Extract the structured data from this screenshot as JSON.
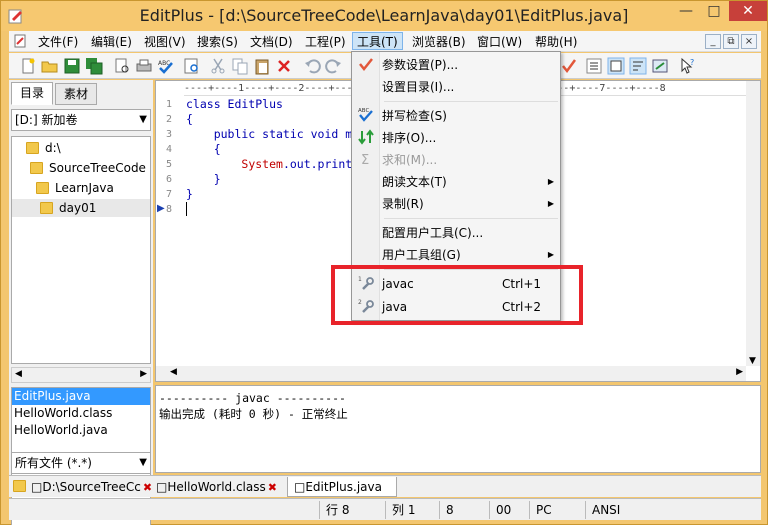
{
  "window": {
    "title": "EditPlus - [d:\\SourceTreeCode\\LearnJava\\day01\\EditPlus.java]"
  },
  "menubar": {
    "items": [
      {
        "label": "文件(F)"
      },
      {
        "label": "编辑(E)"
      },
      {
        "label": "视图(V)"
      },
      {
        "label": "搜索(S)"
      },
      {
        "label": "文档(D)"
      },
      {
        "label": "工程(P)"
      },
      {
        "label": "工具(T)"
      },
      {
        "label": "浏览器(B)"
      },
      {
        "label": "窗口(W)"
      },
      {
        "label": "帮助(H)"
      }
    ]
  },
  "sidebar": {
    "tabs": [
      {
        "label": "目录"
      },
      {
        "label": "素材"
      }
    ],
    "drive": "[D:] 新加卷",
    "tree": [
      {
        "label": "d:\\"
      },
      {
        "label": "SourceTreeCode"
      },
      {
        "label": "LearnJava"
      },
      {
        "label": "day01"
      }
    ],
    "files": [
      {
        "label": "EditPlus.java"
      },
      {
        "label": "HelloWorld.class"
      },
      {
        "label": "HelloWorld.java"
      }
    ],
    "filter": "所有文件 (*.*)"
  },
  "editor": {
    "ruler": "----+----1----+----2----+----3----+----4----+----5----+----6----+----7----+----8",
    "lines": [
      {
        "num": "1",
        "text": "class EditPlus"
      },
      {
        "num": "2",
        "text": "{"
      },
      {
        "num": "3",
        "text": "    public static void m"
      },
      {
        "num": "4",
        "text": "    {"
      },
      {
        "num": "5",
        "pre": "        ",
        "str": "System",
        "post": ".out.print"
      },
      {
        "num": "6",
        "text": "    }"
      },
      {
        "num": "7",
        "text": "}"
      },
      {
        "num": "8",
        "text": ""
      }
    ]
  },
  "output": {
    "lines": [
      "---------- javac ----------",
      "输出完成 (耗时 0 秒) - 正常终止"
    ]
  },
  "doctabs": [
    {
      "label": "D:\\SourceTreeCc"
    },
    {
      "label": "HelloWorld.class"
    },
    {
      "label": "EditPlus.java"
    }
  ],
  "statusbar": {
    "line": "行 8",
    "col": "列 1",
    "val1": "8",
    "val2": "00",
    "mode": "PC",
    "encoding": "ANSI"
  },
  "tools_menu": {
    "items": [
      {
        "label": "参数设置(P)..."
      },
      {
        "label": "设置目录(I)..."
      },
      {
        "label": "拼写检查(S)"
      },
      {
        "label": "排序(O)..."
      },
      {
        "label": "求和(M)..."
      },
      {
        "label": "朗读文本(T)"
      },
      {
        "label": "录制(R)"
      },
      {
        "label": "配置用户工具(C)..."
      },
      {
        "label": "用户工具组(G)"
      },
      {
        "label": "javac",
        "shortcut": "Ctrl+1"
      },
      {
        "label": "java",
        "shortcut": "Ctrl+2"
      }
    ]
  },
  "colors": {
    "frame": "#f3c66f",
    "highlight": "#e8232a",
    "selection": "#3399ff",
    "code": "#0000b0",
    "string": "#c00000"
  }
}
